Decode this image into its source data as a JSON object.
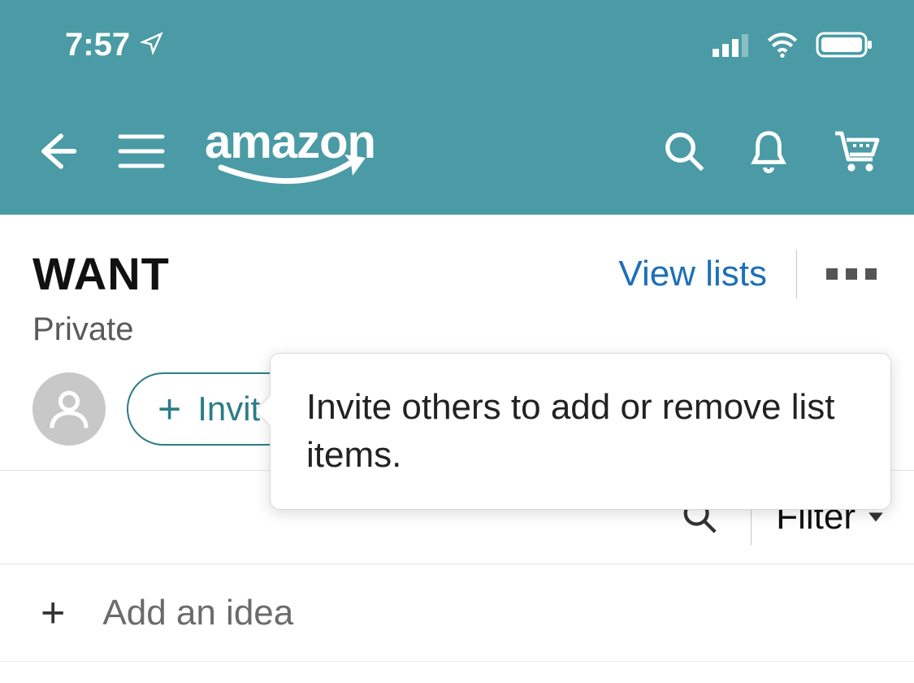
{
  "status": {
    "time": "7:57"
  },
  "header": {
    "logo": "amazon"
  },
  "list": {
    "title": "WANT",
    "privacy": "Private",
    "view_lists": "View lists",
    "invite_label": "Invite",
    "tooltip": "Invite others to add or remove list items."
  },
  "filter": {
    "label": "Filter"
  },
  "add_idea": {
    "label": "Add an idea"
  },
  "colors": {
    "header_bg": "#4a9ba5",
    "link": "#1e6fb8"
  }
}
